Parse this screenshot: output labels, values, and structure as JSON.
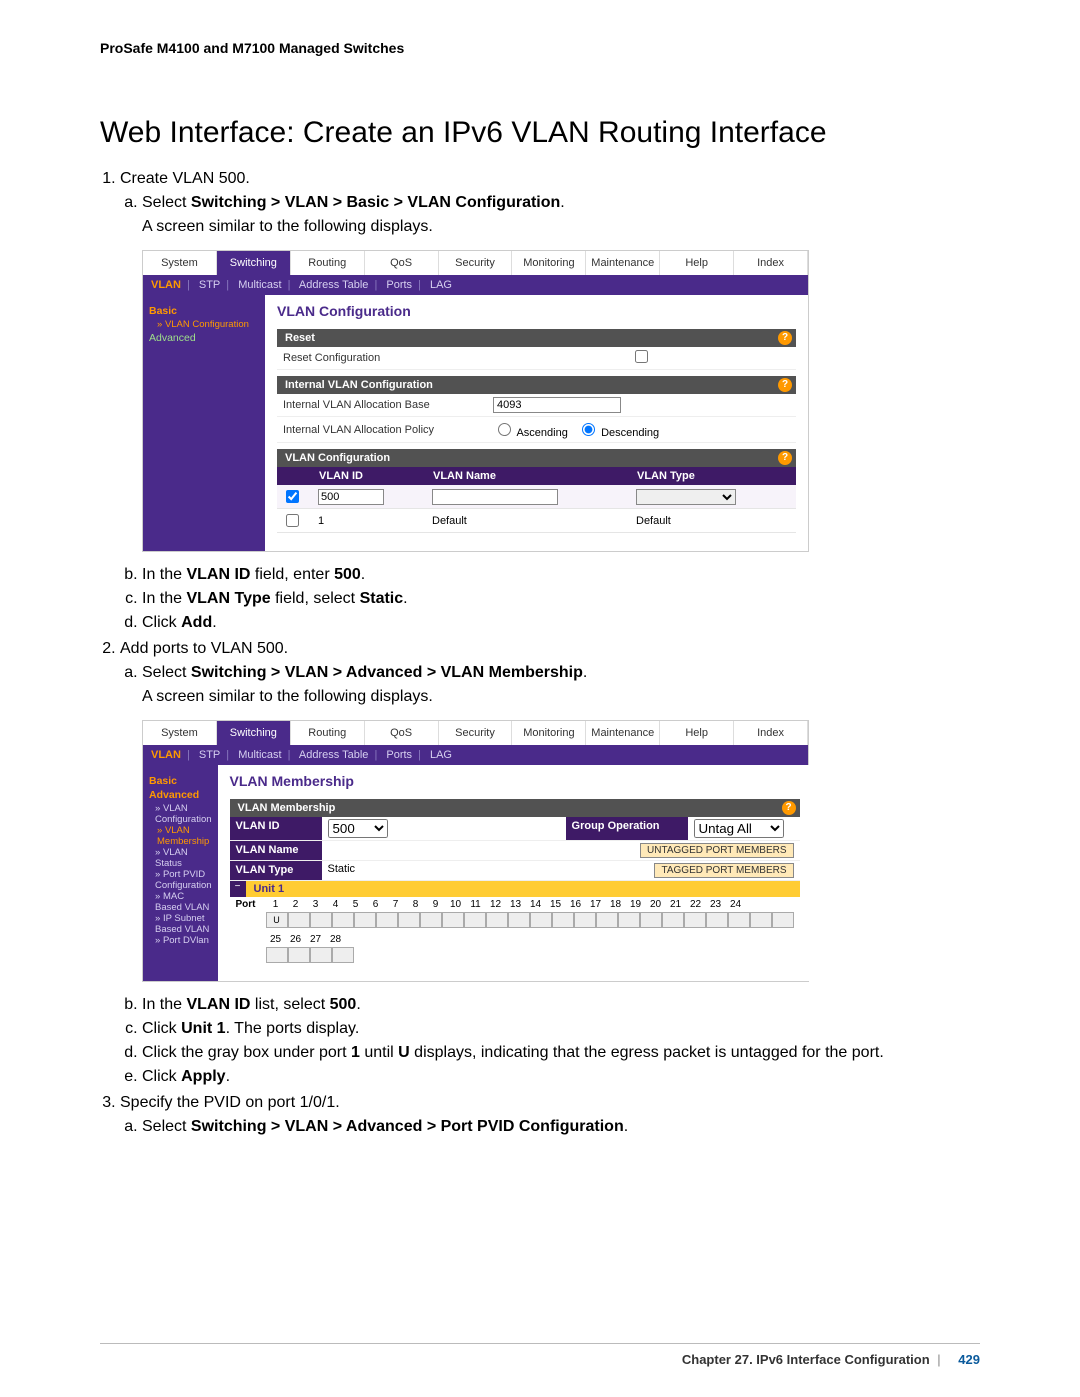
{
  "doc_header": "ProSafe M4100 and M7100 Managed Switches",
  "title": "Web Interface: Create an IPv6 VLAN Routing Interface",
  "steps": {
    "s1": "Create VLAN 500.",
    "s1a_pre": "Select ",
    "s1a_bold": "Switching > VLAN > Basic > VLAN Configuration",
    "s1a_post": ".",
    "s1_intro": "A screen similar to the following displays.",
    "s1b_pre": "In the ",
    "s1b_b1": "VLAN ID",
    "s1b_mid": " field, enter ",
    "s1b_b2": "500",
    "s1b_post": ".",
    "s1c_pre": "In the ",
    "s1c_b1": "VLAN Type",
    "s1c_mid": " field, select ",
    "s1c_b2": "Static",
    "s1c_post": ".",
    "s1d_pre": "Click ",
    "s1d_b": "Add",
    "s1d_post": ".",
    "s2": "Add ports to VLAN 500.",
    "s2a_pre": "Select ",
    "s2a_bold": "Switching > VLAN > Advanced > VLAN Membership",
    "s2a_post": ".",
    "s2_intro": "A screen similar to the following displays.",
    "s2b_pre": "In the ",
    "s2b_b1": "VLAN ID",
    "s2b_mid": " list, select ",
    "s2b_b2": "500",
    "s2b_post": ".",
    "s2c_pre": "Click ",
    "s2c_b": "Unit 1",
    "s2c_post": ". The ports display.",
    "s2d_pre": "Click the gray box under port ",
    "s2d_b1": "1",
    "s2d_mid": " until ",
    "s2d_b2": "U",
    "s2d_post": " displays, indicating that the egress packet is untagged for the port.",
    "s2e_pre": "Click ",
    "s2e_b": "Apply",
    "s2e_post": ".",
    "s3": "Specify the PVID on port 1/0/1.",
    "s3a_pre": "Select ",
    "s3a_bold": "Switching > VLAN > Advanced > Port PVID Configuration",
    "s3a_post": "."
  },
  "shot1": {
    "tabs": [
      "System",
      "Switching",
      "Routing",
      "QoS",
      "Security",
      "Monitoring",
      "Maintenance",
      "Help",
      "Index"
    ],
    "active_tab": "Switching",
    "subtabs": [
      "VLAN",
      "STP",
      "Multicast",
      "Address Table",
      "Ports",
      "LAG"
    ],
    "active_sub": "VLAN",
    "sidebar": {
      "basic": "Basic",
      "vlan_conf": "VLAN Configuration",
      "advanced": "Advanced"
    },
    "content_title": "VLAN Configuration",
    "reset_head": "Reset",
    "reset_label": "Reset Configuration",
    "internal_head": "Internal VLAN Configuration",
    "internal_base_label": "Internal VLAN Allocation Base",
    "internal_base_value": "4093",
    "internal_policy_label": "Internal VLAN Allocation Policy",
    "policy_asc": "Ascending",
    "policy_desc": "Descending",
    "vlan_conf_head": "VLAN Configuration",
    "cols": {
      "id": "VLAN ID",
      "name": "VLAN Name",
      "type": "VLAN Type"
    },
    "new_row": {
      "id": "500",
      "name": "",
      "type": ""
    },
    "existing_row": {
      "id": "1",
      "name": "Default",
      "type": "Default"
    }
  },
  "shot2": {
    "tabs": [
      "System",
      "Switching",
      "Routing",
      "QoS",
      "Security",
      "Monitoring",
      "Maintenance",
      "Help",
      "Index"
    ],
    "active_tab": "Switching",
    "subtabs": [
      "VLAN",
      "STP",
      "Multicast",
      "Address Table",
      "Ports",
      "LAG"
    ],
    "active_sub": "VLAN",
    "sidebar": {
      "basic": "Basic",
      "advanced": "Advanced",
      "items": [
        "VLAN Configuration",
        "VLAN Membership",
        "VLAN Status",
        "Port PVID Configuration",
        "MAC Based VLAN",
        "IP Subnet Based VLAN",
        "Port DVlan"
      ],
      "active": "VLAN Membership"
    },
    "content_title": "VLAN Membership",
    "mem_head": "VLAN Membership",
    "vlan_id_label": "VLAN ID",
    "vlan_id_value": "500",
    "group_op_label": "Group Operation",
    "group_op_value": "Untag All",
    "vlan_name_label": "VLAN Name",
    "vlan_name_value": "",
    "untagged_btn": "UNTAGGED PORT MEMBERS",
    "vlan_type_label": "VLAN Type",
    "vlan_type_value": "Static",
    "tagged_btn": "TAGGED PORT MEMBERS",
    "unit_label": "Unit 1",
    "port_label": "Port",
    "ports_top": [
      "1",
      "2",
      "3",
      "4",
      "5",
      "6",
      "7",
      "8",
      "9",
      "10",
      "11",
      "12",
      "13",
      "14",
      "15",
      "16",
      "17",
      "18",
      "19",
      "20",
      "21",
      "22",
      "23",
      "24"
    ],
    "ports_bottom": [
      "25",
      "26",
      "27",
      "28"
    ],
    "port1_state": "U"
  },
  "footer": {
    "chapter": "Chapter 27.  IPv6 Interface Configuration",
    "page": "429"
  }
}
